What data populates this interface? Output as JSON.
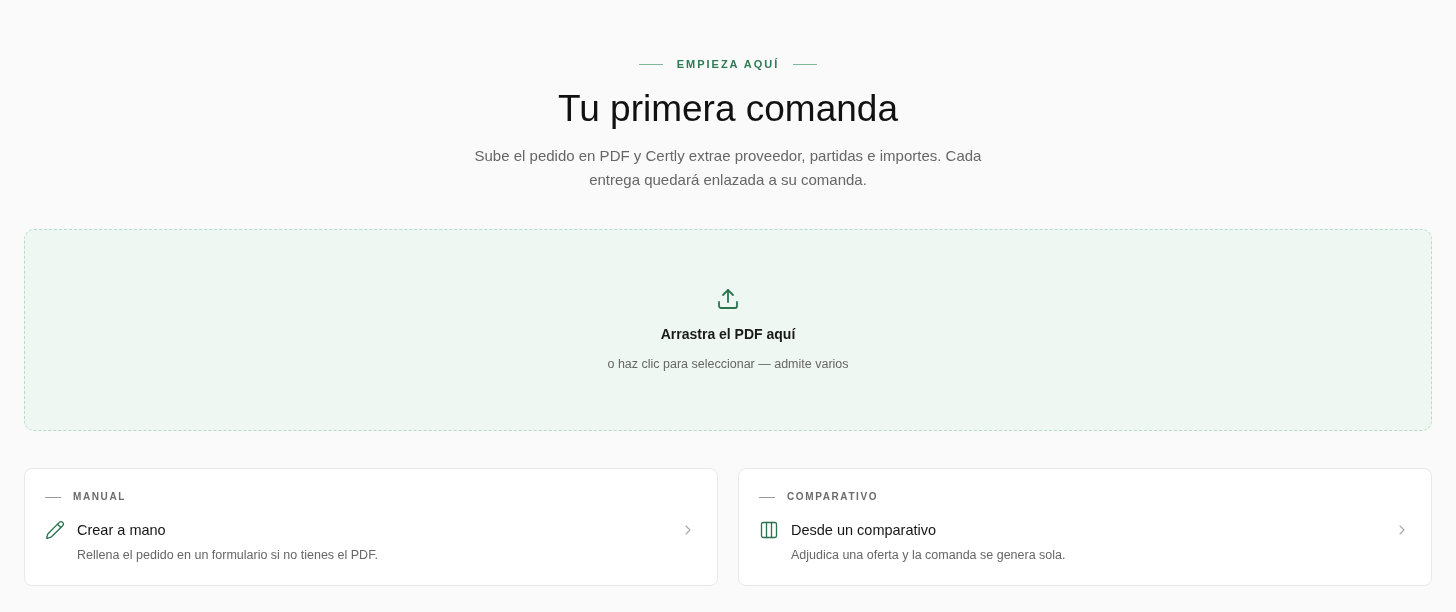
{
  "header": {
    "eyebrow": "EMPIEZA AQUÍ",
    "title": "Tu primera comanda",
    "subtitle": "Sube el pedido en PDF y Certly extrae proveedor, partidas e importes. Cada entrega quedará enlazada a su comanda."
  },
  "dropzone": {
    "title": "Arrastra el PDF aquí",
    "hint": "o haz clic para seleccionar — admite varios"
  },
  "options": [
    {
      "kind": "manual",
      "label": "MANUAL",
      "title": "Crear a mano",
      "description": "Rellena el pedido en un formulario si no tienes el PDF."
    },
    {
      "kind": "comparative",
      "label": "COMPARATIVO",
      "title": "Desde un comparativo",
      "description": "Adjudica una oferta y la comanda se genera sola."
    }
  ]
}
